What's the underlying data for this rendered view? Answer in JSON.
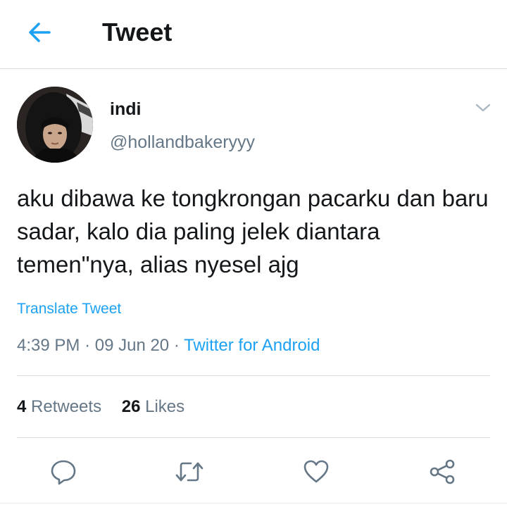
{
  "header": {
    "title": "Tweet",
    "back_icon": "arrow-left-icon"
  },
  "author": {
    "display_name": "indi",
    "handle": "@hollandbakeryyy",
    "menu_icon": "chevron-down-icon"
  },
  "tweet": {
    "text": "aku dibawa ke tongkrongan pacarku dan baru sadar, kalo dia paling jelek diantara temen\"nya, alias nyesel ajg",
    "translate_label": "Translate Tweet",
    "time": "4:39 PM",
    "separator": "·",
    "date": "09 Jun 20",
    "source": "Twitter for Android"
  },
  "stats": {
    "retweets_count": "4",
    "retweets_label": "Retweets",
    "likes_count": "26",
    "likes_label": "Likes"
  },
  "actions": [
    {
      "name": "reply",
      "icon": "reply-icon"
    },
    {
      "name": "retweet",
      "icon": "retweet-icon"
    },
    {
      "name": "like",
      "icon": "heart-icon"
    },
    {
      "name": "share",
      "icon": "share-icon"
    }
  ],
  "colors": {
    "accent": "#1da1f2",
    "text": "#14171a",
    "secondary": "#657786",
    "divider": "#d8dde2"
  }
}
